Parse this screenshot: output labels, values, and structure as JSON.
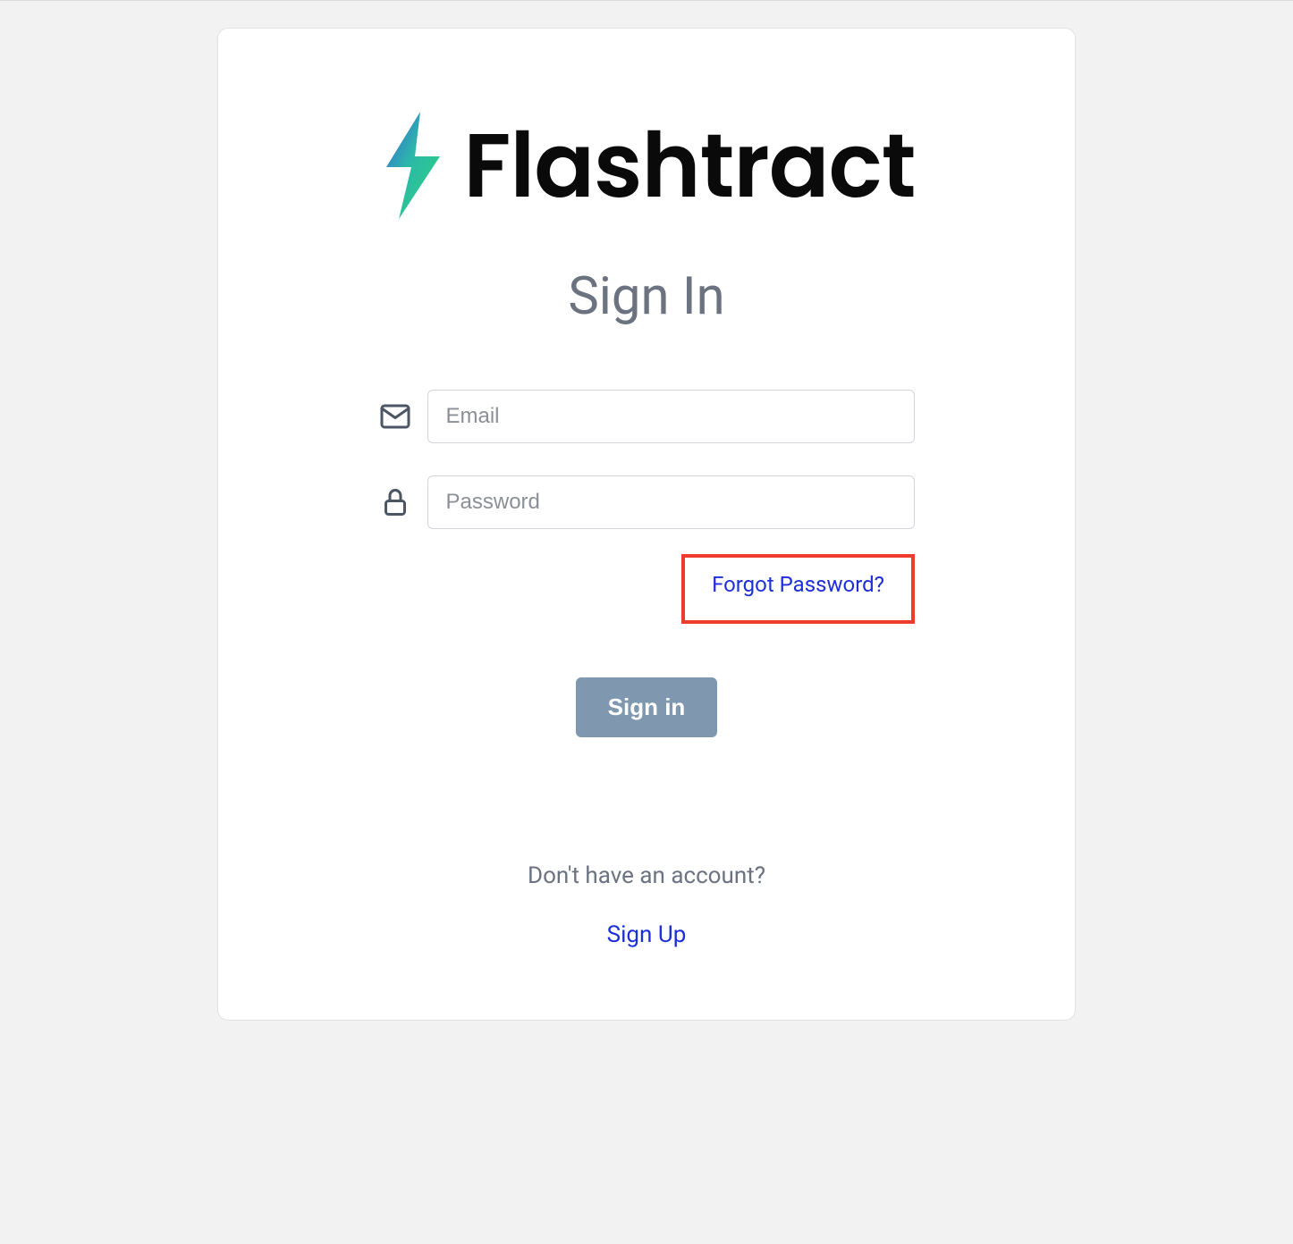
{
  "brand": {
    "name": "Flashtract"
  },
  "page": {
    "title": "Sign In"
  },
  "form": {
    "email_placeholder": "Email",
    "password_placeholder": "Password",
    "forgot_label": "Forgot Password?",
    "submit_label": "Sign in"
  },
  "footer": {
    "no_account_text": "Don't have an account?",
    "signup_label": "Sign Up"
  },
  "colors": {
    "accent_blue": "#1d2fd8",
    "button_bg": "#7f98b0",
    "highlight_border": "#ef3b2d"
  }
}
